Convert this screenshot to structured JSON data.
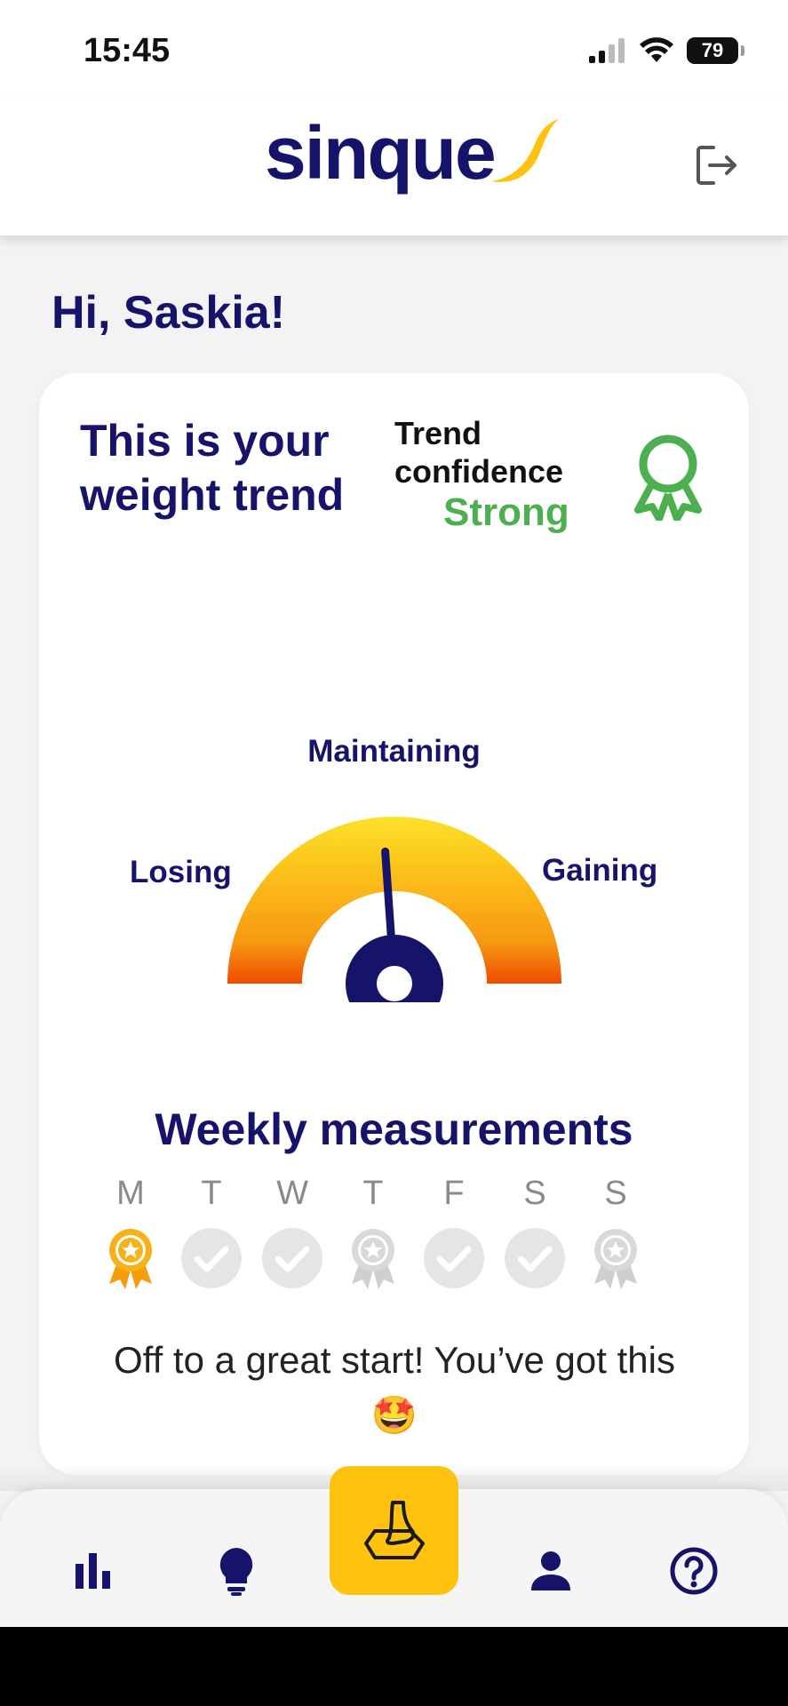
{
  "status_bar": {
    "time": "15:45",
    "battery": "79"
  },
  "header": {
    "logo_text": "sinque"
  },
  "greeting": "Hi, Saskia!",
  "trend_card": {
    "title": "This is your weight trend",
    "confidence_label": "Trend confidence",
    "confidence_value": "Strong",
    "gauge": {
      "labels": {
        "left": "Losing",
        "top": "Maintaining",
        "right": "Gaining"
      },
      "needle_position_deg": 4
    }
  },
  "weekly": {
    "title": "Weekly measurements",
    "days": [
      {
        "letter": "M",
        "status": "gold-medal"
      },
      {
        "letter": "T",
        "status": "check"
      },
      {
        "letter": "W",
        "status": "check"
      },
      {
        "letter": "T",
        "status": "gray-medal"
      },
      {
        "letter": "F",
        "status": "check"
      },
      {
        "letter": "S",
        "status": "check"
      },
      {
        "letter": "S",
        "status": "gray-medal"
      }
    ],
    "message": "Off to a great start! You’ve got this 🤩"
  },
  "colors": {
    "brand_navy": "#15136a",
    "brand_yellow": "#ffc20e",
    "confidence_green": "#4caf50"
  },
  "nav": {
    "items": [
      "stats-icon",
      "lightbulb-icon",
      "scale-icon",
      "profile-icon",
      "help-icon"
    ]
  }
}
